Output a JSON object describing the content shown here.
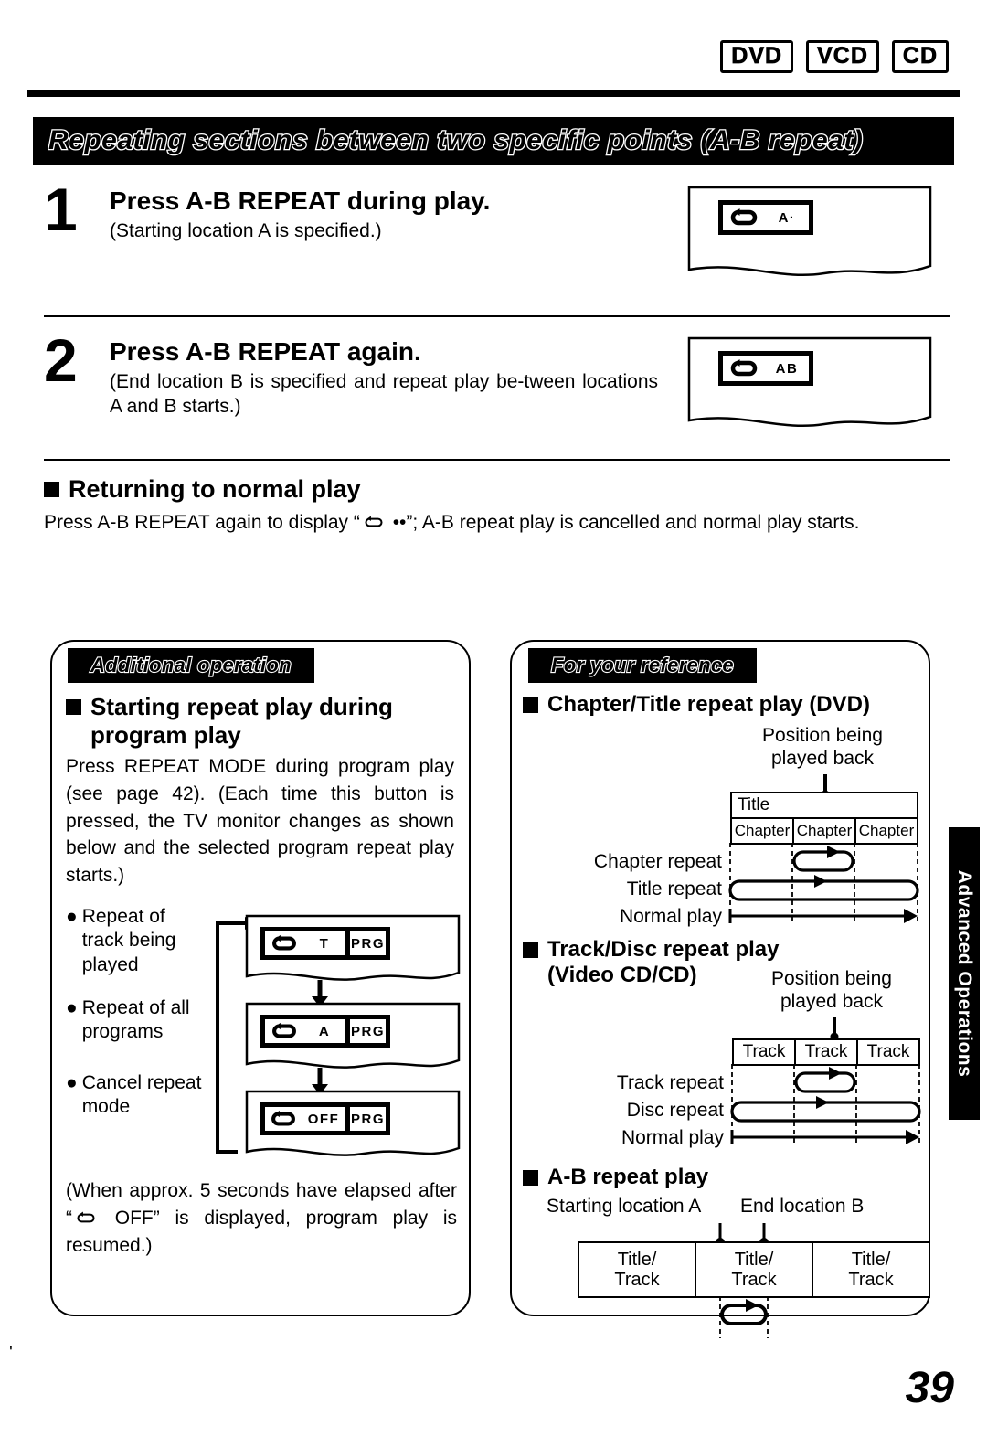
{
  "media_badges": [
    "DVD",
    "VCD",
    "CD"
  ],
  "section_title": "Repeating sections between two specific points (A-B repeat)",
  "steps": [
    {
      "number": "1",
      "title": "Press A-B REPEAT during play.",
      "subtitle": "(Starting location A is specified.)",
      "osd": {
        "icon": "repeat-icon",
        "text": "A·"
      }
    },
    {
      "number": "2",
      "title": "Press A-B REPEAT again.",
      "subtitle": "(End location B is specified and repeat play be-tween locations A and B starts.)",
      "osd": {
        "icon": "repeat-icon",
        "text": "AB"
      }
    }
  ],
  "normal_play": {
    "heading": "Returning to normal play",
    "text_before": "Press A-B REPEAT again to display “",
    "text_after": " ••”; A-B repeat play is cancelled and normal play starts."
  },
  "left_panel": {
    "tag": "Additional operation",
    "heading_line1": "Starting repeat play during",
    "heading_line2": "program play",
    "body": "Press REPEAT MODE during program play (see page 42). (Each time this button is pressed, the TV monitor changes as shown below and the selected program repeat play starts.)",
    "bullets": [
      {
        "marker": "●",
        "lines": [
          "Repeat of",
          "track being",
          "played"
        ],
        "osd": {
          "mode": "T",
          "prg": "PRG"
        }
      },
      {
        "marker": "●",
        "lines": [
          "Repeat of all",
          "programs"
        ],
        "osd": {
          "mode": "A",
          "prg": "PRG"
        }
      },
      {
        "marker": "●",
        "lines": [
          "Cancel repeat",
          "mode"
        ],
        "osd": {
          "mode": "OFF",
          "prg": "PRG"
        }
      }
    ],
    "footer_before": "(When approx. 5 seconds have elapsed after “",
    "footer_after": " OFF” is displayed, program play is resumed.)"
  },
  "right_panel": {
    "tag": "For your reference",
    "sections": [
      {
        "heading": "Chapter/Title repeat play (DVD)",
        "position_label_line1": "Position being",
        "position_label_line2": "played back",
        "top_row_label": "Title",
        "cells": [
          "Chapter",
          "Chapter",
          "Chapter"
        ],
        "rows": [
          "Chapter repeat",
          "Title repeat",
          "Normal play"
        ]
      },
      {
        "heading_line1": "Track/Disc repeat play",
        "heading_line2": "(Video CD/CD)",
        "position_label_line1": "Position being",
        "position_label_line2": "played back",
        "cells": [
          "Track",
          "Track",
          "Track"
        ],
        "rows": [
          "Track repeat",
          "Disc repeat",
          "Normal play"
        ]
      },
      {
        "heading": "A-B repeat play",
        "marker_a": "Starting location A",
        "marker_b": "End location B",
        "cells": [
          "Title/\nTrack",
          "Title/\nTrack",
          "Title/\nTrack"
        ],
        "cell_line1": "Title/",
        "cell_line2": "Track"
      }
    ]
  },
  "side_tab": "Advanced Operations",
  "page_number": "39"
}
